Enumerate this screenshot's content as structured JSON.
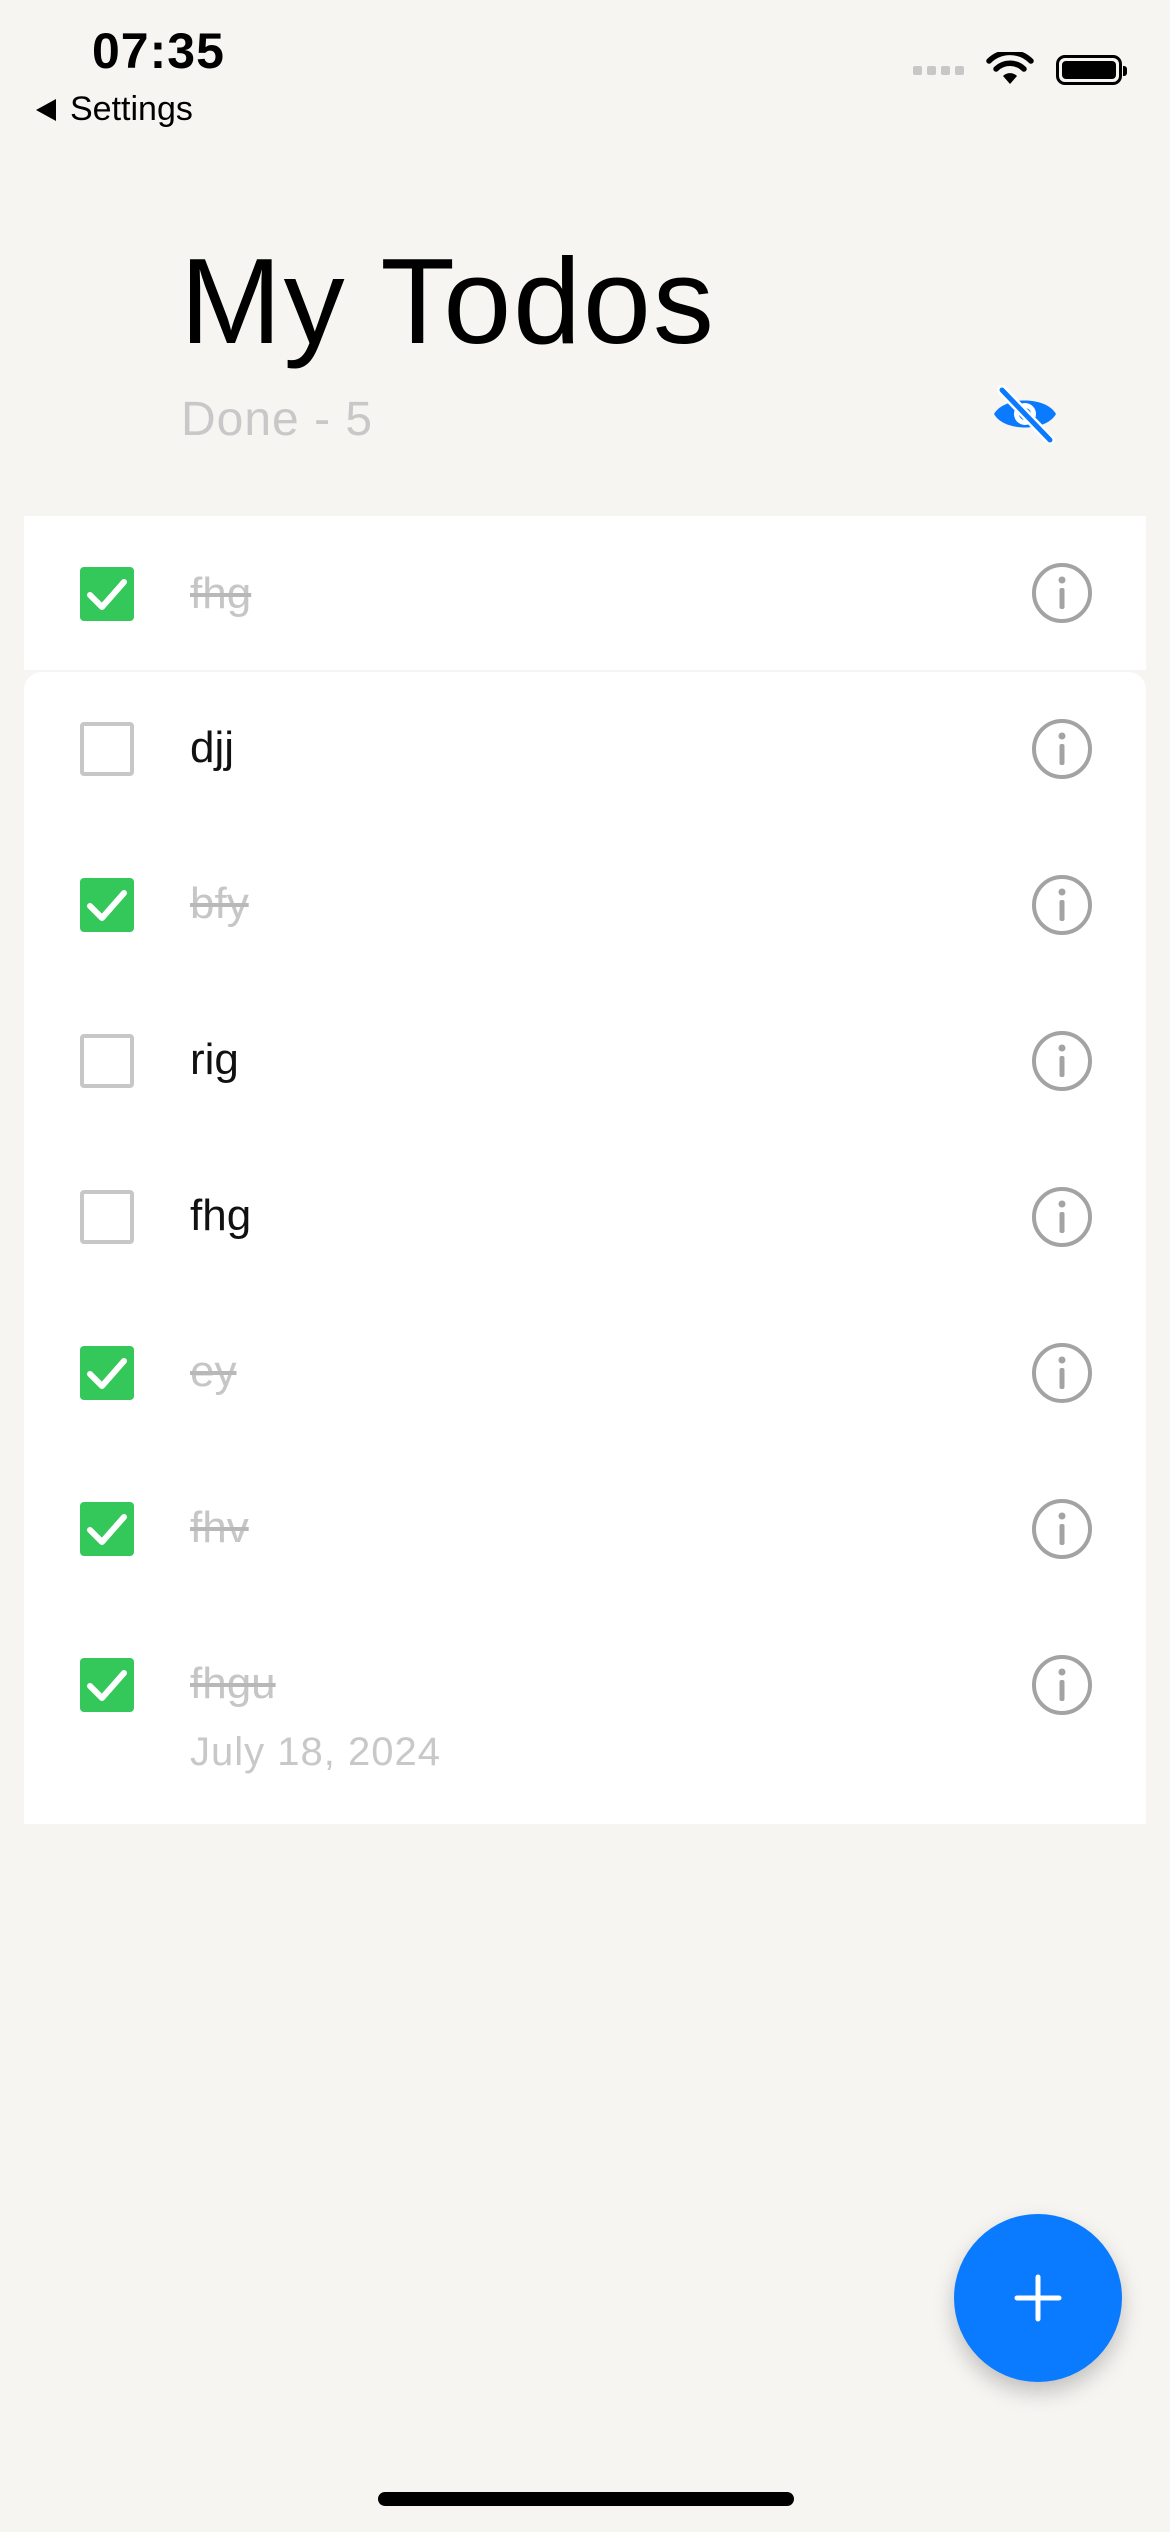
{
  "status_bar": {
    "time": "07:35",
    "back_label": "Settings"
  },
  "header": {
    "title": "My Todos",
    "done_label": "Done - 5",
    "toggle_icon": "eye-slash-icon"
  },
  "todos": [
    {
      "text": "fhg",
      "done": true,
      "date": ""
    },
    {
      "text": "djj",
      "done": false,
      "date": ""
    },
    {
      "text": "bfy",
      "done": true,
      "date": ""
    },
    {
      "text": "rig",
      "done": false,
      "date": ""
    },
    {
      "text": "fhg",
      "done": false,
      "date": ""
    },
    {
      "text": "ey",
      "done": true,
      "date": ""
    },
    {
      "text": "fhv",
      "done": true,
      "date": ""
    },
    {
      "text": "fhgu",
      "done": true,
      "date": "July 18, 2024"
    }
  ],
  "colors": {
    "accent": "#0a7aff",
    "checked": "#34c759",
    "background": "#f6f5f2"
  },
  "fab": {
    "icon": "plus-icon"
  }
}
